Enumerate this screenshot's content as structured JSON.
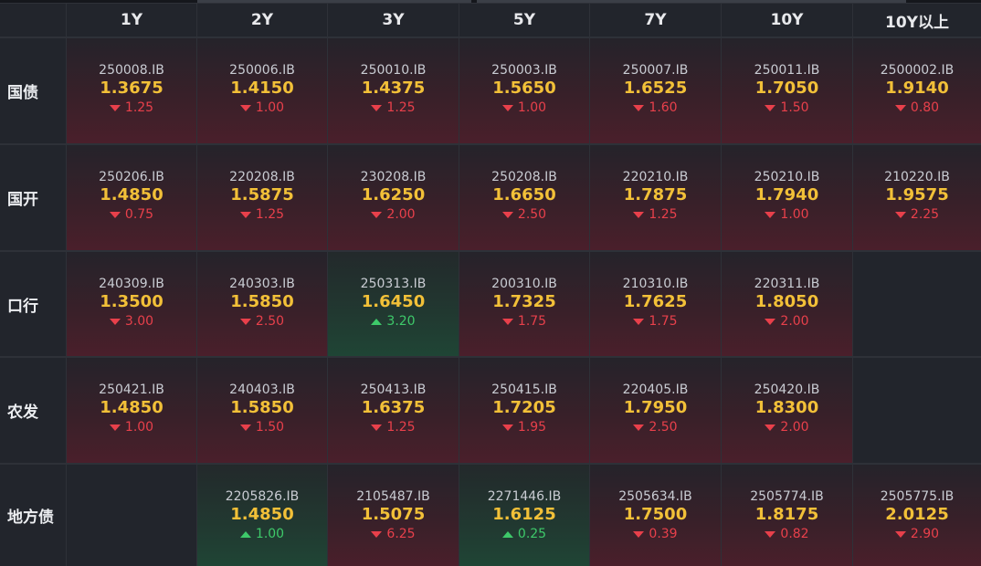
{
  "columns": [
    "1Y",
    "2Y",
    "3Y",
    "5Y",
    "7Y",
    "10Y",
    "10Y以上"
  ],
  "rows": [
    {
      "label": "国债",
      "cells": [
        {
          "code": "250008.IB",
          "price": "1.3675",
          "change": "1.25",
          "dir": "down"
        },
        {
          "code": "250006.IB",
          "price": "1.4150",
          "change": "1.00",
          "dir": "down"
        },
        {
          "code": "250010.IB",
          "price": "1.4375",
          "change": "1.25",
          "dir": "down"
        },
        {
          "code": "250003.IB",
          "price": "1.5650",
          "change": "1.00",
          "dir": "down"
        },
        {
          "code": "250007.IB",
          "price": "1.6525",
          "change": "1.60",
          "dir": "down"
        },
        {
          "code": "250011.IB",
          "price": "1.7050",
          "change": "1.50",
          "dir": "down"
        },
        {
          "code": "2500002.IB",
          "price": "1.9140",
          "change": "0.80",
          "dir": "down"
        }
      ]
    },
    {
      "label": "国开",
      "cells": [
        {
          "code": "250206.IB",
          "price": "1.4850",
          "change": "0.75",
          "dir": "down"
        },
        {
          "code": "220208.IB",
          "price": "1.5875",
          "change": "1.25",
          "dir": "down"
        },
        {
          "code": "230208.IB",
          "price": "1.6250",
          "change": "2.00",
          "dir": "down"
        },
        {
          "code": "250208.IB",
          "price": "1.6650",
          "change": "2.50",
          "dir": "down"
        },
        {
          "code": "220210.IB",
          "price": "1.7875",
          "change": "1.25",
          "dir": "down"
        },
        {
          "code": "250210.IB",
          "price": "1.7940",
          "change": "1.00",
          "dir": "down"
        },
        {
          "code": "210220.IB",
          "price": "1.9575",
          "change": "2.25",
          "dir": "down"
        }
      ]
    },
    {
      "label": "口行",
      "cells": [
        {
          "code": "240309.IB",
          "price": "1.3500",
          "change": "3.00",
          "dir": "down"
        },
        {
          "code": "240303.IB",
          "price": "1.5850",
          "change": "2.50",
          "dir": "down"
        },
        {
          "code": "250313.IB",
          "price": "1.6450",
          "change": "3.20",
          "dir": "up"
        },
        {
          "code": "200310.IB",
          "price": "1.7325",
          "change": "1.75",
          "dir": "down"
        },
        {
          "code": "210310.IB",
          "price": "1.7625",
          "change": "1.75",
          "dir": "down"
        },
        {
          "code": "220311.IB",
          "price": "1.8050",
          "change": "2.00",
          "dir": "down"
        },
        null
      ]
    },
    {
      "label": "农发",
      "cells": [
        {
          "code": "250421.IB",
          "price": "1.4850",
          "change": "1.00",
          "dir": "down"
        },
        {
          "code": "240403.IB",
          "price": "1.5850",
          "change": "1.50",
          "dir": "down"
        },
        {
          "code": "250413.IB",
          "price": "1.6375",
          "change": "1.25",
          "dir": "down"
        },
        {
          "code": "250415.IB",
          "price": "1.7205",
          "change": "1.95",
          "dir": "down"
        },
        {
          "code": "220405.IB",
          "price": "1.7950",
          "change": "2.50",
          "dir": "down"
        },
        {
          "code": "250420.IB",
          "price": "1.8300",
          "change": "2.00",
          "dir": "down"
        },
        null
      ]
    },
    {
      "label": "地方债",
      "cells": [
        null,
        {
          "code": "2205826.IB",
          "price": "1.4850",
          "change": "1.00",
          "dir": "up"
        },
        {
          "code": "2105487.IB",
          "price": "1.5075",
          "change": "6.25",
          "dir": "down"
        },
        {
          "code": "2271446.IB",
          "price": "1.6125",
          "change": "0.25",
          "dir": "up"
        },
        {
          "code": "2505634.IB",
          "price": "1.7500",
          "change": "0.39",
          "dir": "down"
        },
        {
          "code": "2505774.IB",
          "price": "1.8175",
          "change": "0.82",
          "dir": "down"
        },
        {
          "code": "2505775.IB",
          "price": "2.0125",
          "change": "2.90",
          "dir": "down"
        }
      ]
    }
  ],
  "colors": {
    "price": "#f2c038",
    "down": "#e8404b",
    "up": "#3ec96a"
  },
  "icons": {
    "down": "triangle-down-icon",
    "up": "triangle-up-icon"
  }
}
